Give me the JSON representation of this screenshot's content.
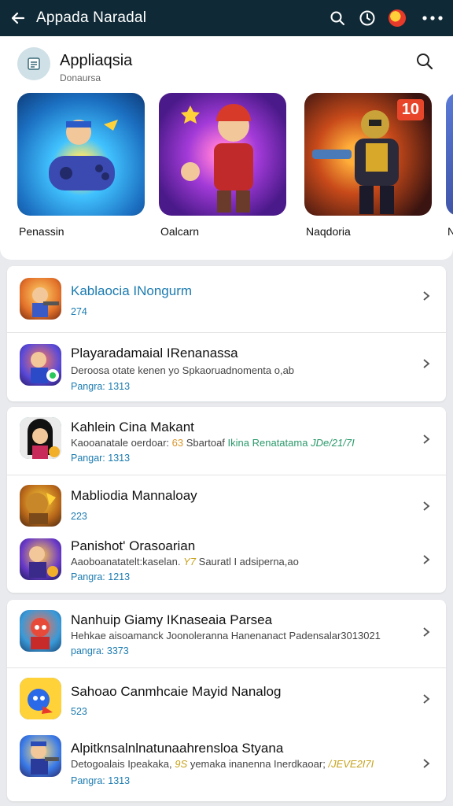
{
  "topbar": {
    "title": "Appada Naradal",
    "icons": [
      "back-arrow-icon",
      "search-icon",
      "timer-icon",
      "avatar-icon",
      "more-icon"
    ]
  },
  "hero": {
    "app_name": "Appliaqsia",
    "app_sub": "Donaursa",
    "tiles": [
      {
        "label": "Penassin"
      },
      {
        "label": "Oalcarn"
      },
      {
        "label": "Naqdoria",
        "badge": "10"
      },
      {
        "label": "N"
      }
    ]
  },
  "list": {
    "cards": [
      {
        "rows": [
          {
            "title": "Kablaocia INongurm",
            "sub": "",
            "meta": "274"
          },
          {
            "title": "Playaradamaial IRenanassa",
            "sub": "Deroosa otate kenen yo Spkaoruadnomenta o,ab",
            "meta": "Pangra: 1313"
          }
        ]
      },
      {
        "rows": [
          {
            "title": "Kahlein Cina Makant",
            "sub_a": "Kaooanatale oerdoar:",
            "sub_b": "63",
            "sub_c": "Sbartoaf",
            "sub_d": "Ikina Renatatama",
            "sub_e": "JDe/21/7I",
            "meta": "Pangar: 1313"
          },
          {
            "title": "Mabliodia Mannaloay",
            "sub": "",
            "meta": "223"
          },
          {
            "title": "Panishot' Orasoarian",
            "sub_a": "Aaoboanatatelt:kaselan.",
            "sub_b": "Y7",
            "sub_c": "Sauratl I adsiperna,ao",
            "meta": "Pangra: 1213"
          }
        ]
      },
      {
        "rows": [
          {
            "title": "Nanhuip Giamy IKnaseaia Parsea",
            "sub": "Hehkae aisoamanck Joonoleranna Hanenanact Padensalar3013021",
            "meta": "pangra: 3373"
          },
          {
            "title": "Sahoao Canmhcaie Mayid Nanalog",
            "sub": "",
            "meta": "523"
          },
          {
            "title": "Alpitknsalnlnatunaahrensloa Styana",
            "sub_a": "Detogoalais Ipeakaka,",
            "sub_b": "9S",
            "sub_c": "yemaka inanenna Inerdkaoar;",
            "sub_d": "/JEVE2I7I",
            "meta": "Pangra: 1313"
          }
        ]
      }
    ]
  },
  "colors": {
    "topbar_bg": "#0f2a36",
    "accent_blue": "#1b7bb0"
  }
}
